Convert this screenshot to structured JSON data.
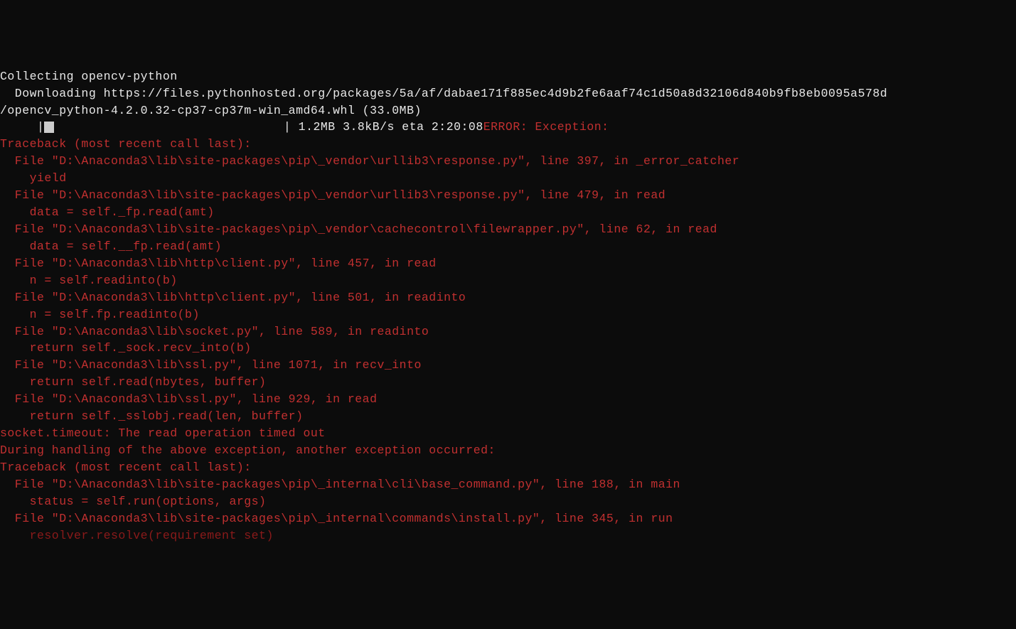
{
  "terminal": {
    "lines": {
      "collecting": "Collecting opencv-python",
      "downloading": "  Downloading https://files.pythonhosted.org/packages/5a/af/dabae171f885ec4d9b2fe6aaf74c1d50a8d32106d840b9fb8eb0095a578d",
      "wheel": "/opencv_python-4.2.0.32-cp37-cp37m-win_amd64.whl (33.0MB)",
      "progress_prefix": "     |",
      "progress_spaces": "                               | 1.2MB 3.8kB/s eta 2:20:08",
      "error_label": "ERROR: Exception:",
      "traceback1": "Traceback (most recent call last):",
      "file1": "  File \"D:\\Anaconda3\\lib\\site-packages\\pip\\_vendor\\urllib3\\response.py\", line 397, in _error_catcher",
      "code1": "    yield",
      "file2": "  File \"D:\\Anaconda3\\lib\\site-packages\\pip\\_vendor\\urllib3\\response.py\", line 479, in read",
      "code2": "    data = self._fp.read(amt)",
      "file3": "  File \"D:\\Anaconda3\\lib\\site-packages\\pip\\_vendor\\cachecontrol\\filewrapper.py\", line 62, in read",
      "code3": "    data = self.__fp.read(amt)",
      "file4": "  File \"D:\\Anaconda3\\lib\\http\\client.py\", line 457, in read",
      "code4": "    n = self.readinto(b)",
      "file5": "  File \"D:\\Anaconda3\\lib\\http\\client.py\", line 501, in readinto",
      "code5": "    n = self.fp.readinto(b)",
      "file6": "  File \"D:\\Anaconda3\\lib\\socket.py\", line 589, in readinto",
      "code6": "    return self._sock.recv_into(b)",
      "file7": "  File \"D:\\Anaconda3\\lib\\ssl.py\", line 1071, in recv_into",
      "code7": "    return self.read(nbytes, buffer)",
      "file8": "  File \"D:\\Anaconda3\\lib\\ssl.py\", line 929, in read",
      "code8": "    return self._sslobj.read(len, buffer)",
      "timeout": "socket.timeout: The read operation timed out",
      "blank": "",
      "during": "During handling of the above exception, another exception occurred:",
      "blank2": "",
      "traceback2": "Traceback (most recent call last):",
      "file9": "  File \"D:\\Anaconda3\\lib\\site-packages\\pip\\_internal\\cli\\base_command.py\", line 188, in main",
      "code9": "    status = self.run(options, args)",
      "file10": "  File \"D:\\Anaconda3\\lib\\site-packages\\pip\\_internal\\commands\\install.py\", line 345, in run",
      "code10": "    resolver.resolve(requirement set)"
    }
  }
}
